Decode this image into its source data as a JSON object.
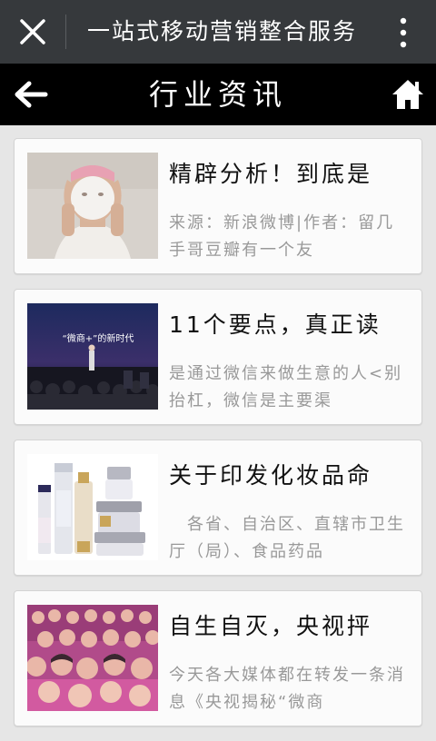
{
  "topbar": {
    "title": "一站式移动营销整合服务"
  },
  "header": {
    "title": "行业资讯"
  },
  "articles": [
    {
      "title": "精辟分析！到底是",
      "summary": "来源：新浪微博|作者：留几手哥豆瓣有一个友"
    },
    {
      "title": "11个要点，真正读",
      "summary": "是通过微信来做生意的人<别抬杠，微信是主要渠",
      "image_caption": "“微商+”的新时代"
    },
    {
      "title": "关于印发化妆品命",
      "summary": "　各省、自治区、直辖市卫生厅（局）、食品药品"
    },
    {
      "title": "自生自灭，央视抨",
      "summary": "今天各大媒体都在转发一条消息《央视揭秘“微商"
    }
  ]
}
